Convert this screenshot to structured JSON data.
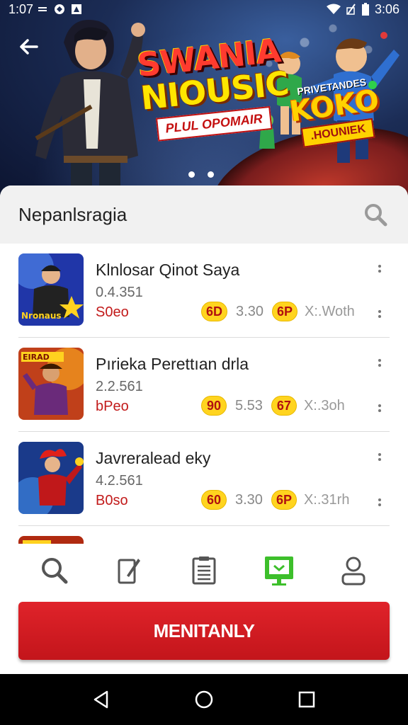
{
  "status_bar": {
    "time_left": "1:07",
    "time_right": "3:06",
    "icons": [
      "signal-icon",
      "sync-icon",
      "notification-icon",
      "wifi-icon",
      "no-sim-icon",
      "battery-icon"
    ]
  },
  "hero": {
    "title_line1": "SWANIA",
    "title_line2": "NIOUSIC",
    "title_tag": "PLUL OPOMAIR",
    "badge_top": "PRIVETANDES",
    "badge_main": "KOKO",
    "badge_sub": ".HOUNIEK",
    "slide_count": 2
  },
  "search": {
    "title": "Nepanlsragia"
  },
  "list_items": [
    {
      "name": "Klnlosar Qinot Saya",
      "version": "0.4.351",
      "price": "S0eo",
      "pill1": "6D",
      "stat1": "3.30",
      "pill2": "6P",
      "stat_text": "X:.Woth"
    },
    {
      "name": "Pırieka Perettıan drla",
      "version": "2.2.561",
      "price": "bPeo",
      "pill1": "90",
      "stat1": "5.53",
      "pill2": "67",
      "stat_text": "X:.3oh"
    },
    {
      "name": "Javreralead eky",
      "version": "4.2.561",
      "price": "B0so",
      "pill1": "60",
      "stat1": "3.30",
      "pill2": "6P",
      "stat_text": "X:.31rh"
    }
  ],
  "bottom_nav": {
    "items": [
      "search-icon",
      "edit-icon",
      "document-icon",
      "monitor-icon",
      "profile-icon"
    ],
    "active_index": 3
  },
  "cta": {
    "label": "MENITANLY"
  },
  "colors": {
    "accent_red": "#d81e24",
    "active_green": "#3dbf2b",
    "price_red": "#c21a1a",
    "pill_yellow": "#ffd41f"
  }
}
